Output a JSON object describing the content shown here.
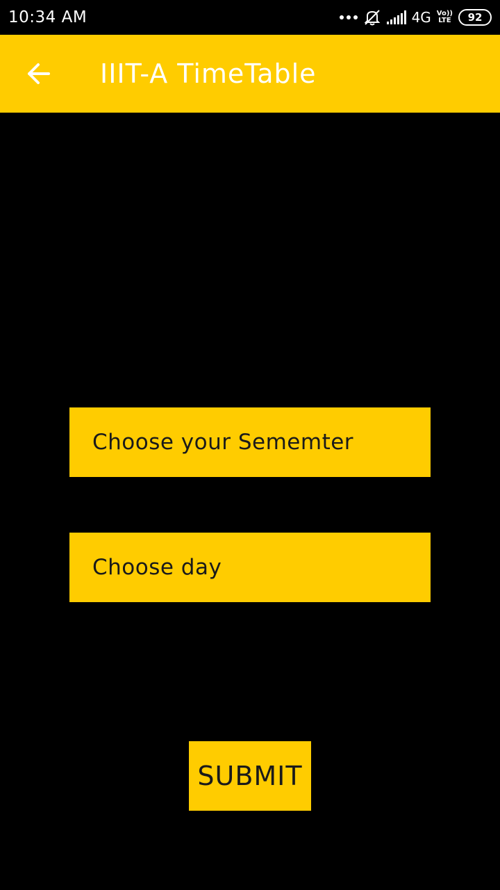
{
  "status_bar": {
    "time": "10:34 AM",
    "network": "4G",
    "volte_top": "Vo))",
    "volte_bottom": "LTE",
    "battery": "92",
    "icons": [
      "more-dots-icon",
      "alarm-off-icon",
      "signal-bars-icon",
      "battery-icon"
    ]
  },
  "app_bar": {
    "title": "IIIT-A TimeTable",
    "back_icon": "arrow-back-icon",
    "background": "#ffcc00",
    "title_color": "#ffffff"
  },
  "form": {
    "semester_label": "Choose your Sememter",
    "day_label": "Choose day",
    "submit_label": "SUBMIT",
    "accent": "#ffcc00",
    "background": "#000000"
  }
}
